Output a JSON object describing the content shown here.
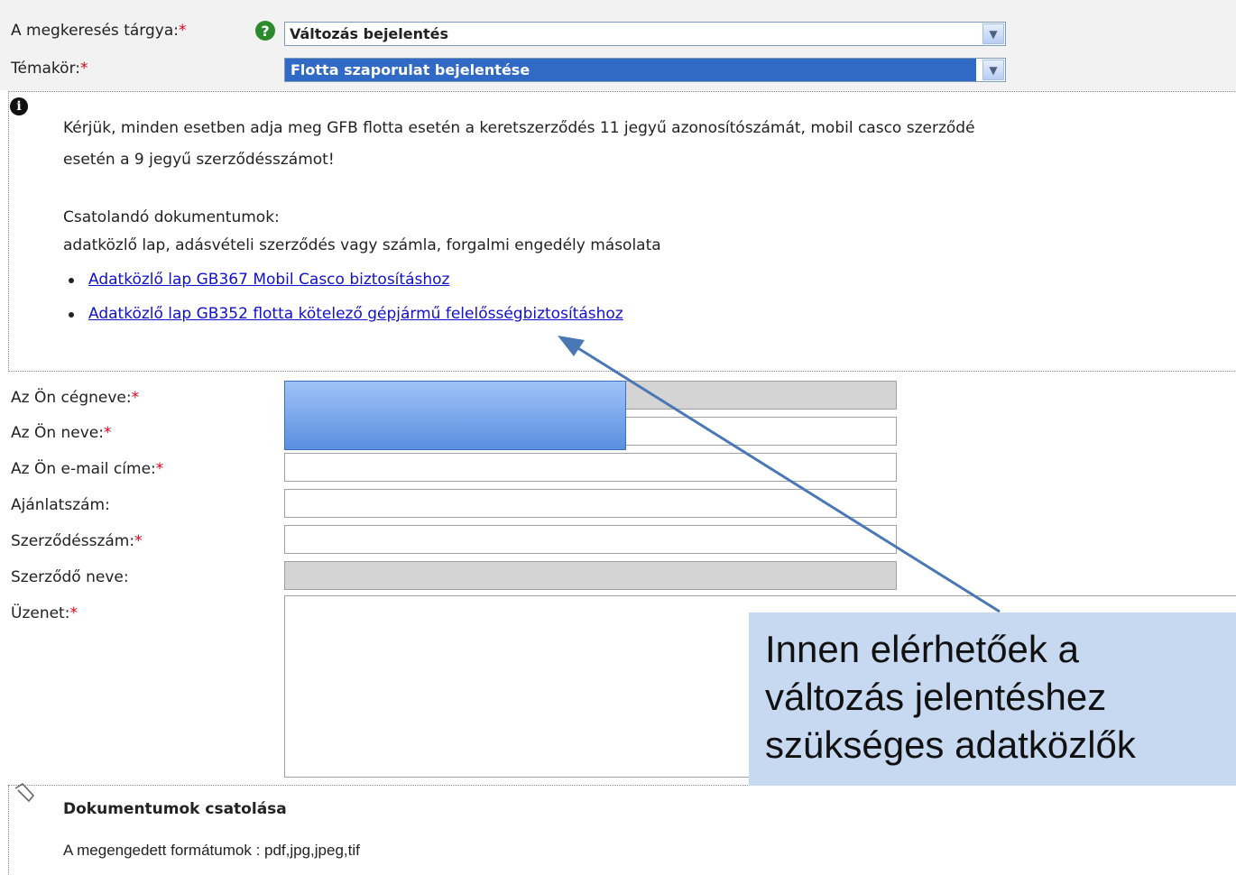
{
  "form": {
    "subject": {
      "label": "A megkeresés tárgya:",
      "required": "*",
      "help_icon": "question-icon",
      "value": "Változás bejelentés"
    },
    "topic": {
      "label": "Témakör:",
      "required": "*",
      "value": "Flotta szaporulat bejelentése"
    },
    "dropdown_arrow": "▼"
  },
  "info": {
    "icon": "info-icon",
    "line1": "Kérjük, minden esetben adja meg GFB flotta esetén a keretszerződés 11 jegyű azonosítószámát, mobil casco szerződé",
    "line2": "esetén a 9 jegyű szerződésszámot!",
    "docs_title": "Csatolandó dokumentumok:",
    "docs_desc": "adatközlő lap, adásvételi szerződés vagy számla, forgalmi engedély másolata",
    "links": [
      "Adatközlő lap GB367 Mobil Casco biztosításhoz",
      "Adatközlő lap GB352 flotta kötelező gépjármű felelősségbiztosításhoz"
    ]
  },
  "fields": {
    "company": {
      "label": "Az Ön cégneve:",
      "required": "*"
    },
    "name": {
      "label": "Az Ön neve:",
      "required": "*"
    },
    "email": {
      "label": "Az Ön e-mail címe:",
      "required": "*"
    },
    "offer": {
      "label": "Ajánlatszám:"
    },
    "contract": {
      "label": "Szerződésszám:",
      "required": "*"
    },
    "contractor": {
      "label": "Szerződő neve:"
    },
    "message": {
      "label": "Üzenet:",
      "required": "*"
    }
  },
  "attachments": {
    "icon": "paperclip-icon",
    "title": "Dokumentumok csatolása",
    "formats": "A megengedett formátumok : pdf,jpg,jpeg,tif"
  },
  "annotation": {
    "callout_lines": [
      "Innen elérhetőek a",
      "változás jelentéshez",
      "szükséges adatközlők"
    ],
    "arrow_color": "#4a78b5",
    "callout_color": "#c6d9f1"
  },
  "colors": {
    "required": "#e0001a",
    "link": "#1111cc",
    "selection": "#316ac5"
  }
}
